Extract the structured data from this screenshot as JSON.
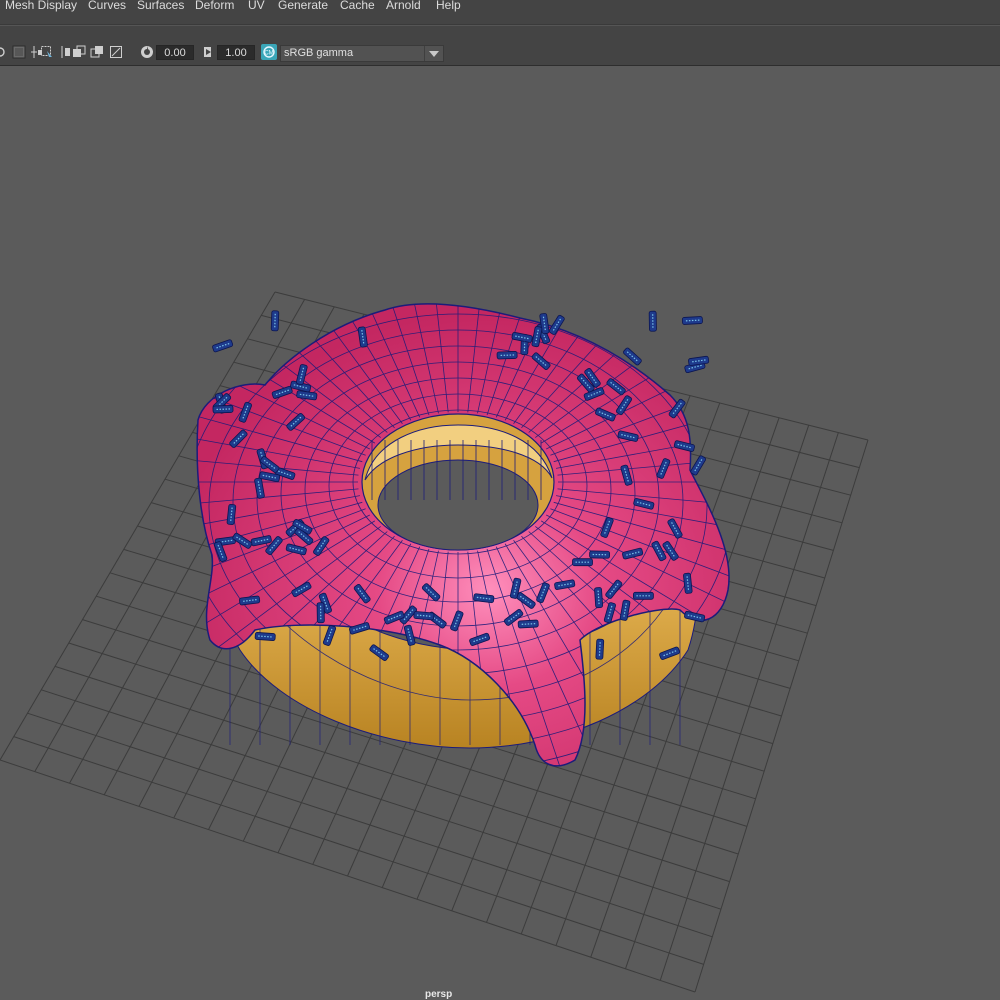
{
  "menubar": {
    "items": [
      {
        "label": "Mesh Display"
      },
      {
        "label": "Curves"
      },
      {
        "label": "Surfaces"
      },
      {
        "label": "Deform"
      },
      {
        "label": "UV"
      },
      {
        "label": "Generate"
      },
      {
        "label": "Cache"
      },
      {
        "label": "Arnold"
      },
      {
        "label": "Help"
      }
    ]
  },
  "panel_toolbar": {
    "exposure_value": "0.00",
    "gamma_value": "1.00",
    "view_transform": "sRGB gamma",
    "icons": [
      "view-icon",
      "shaded-swatch-icon",
      "grid-toggle-icon",
      "resolution-gate-icon",
      "safe-frame-icon",
      "field-chart-icon",
      "exposure-icon",
      "gamma-icon",
      "color-management-icon"
    ]
  },
  "viewport": {
    "camera": "persp",
    "colors": {
      "background": "#5b5b5b",
      "grid": "#3c3c3c",
      "icing": "#d9346e",
      "dough": "#d6a23f",
      "wireframe": "#1c1c7a",
      "sprinkle": "#1e3a8c"
    }
  }
}
